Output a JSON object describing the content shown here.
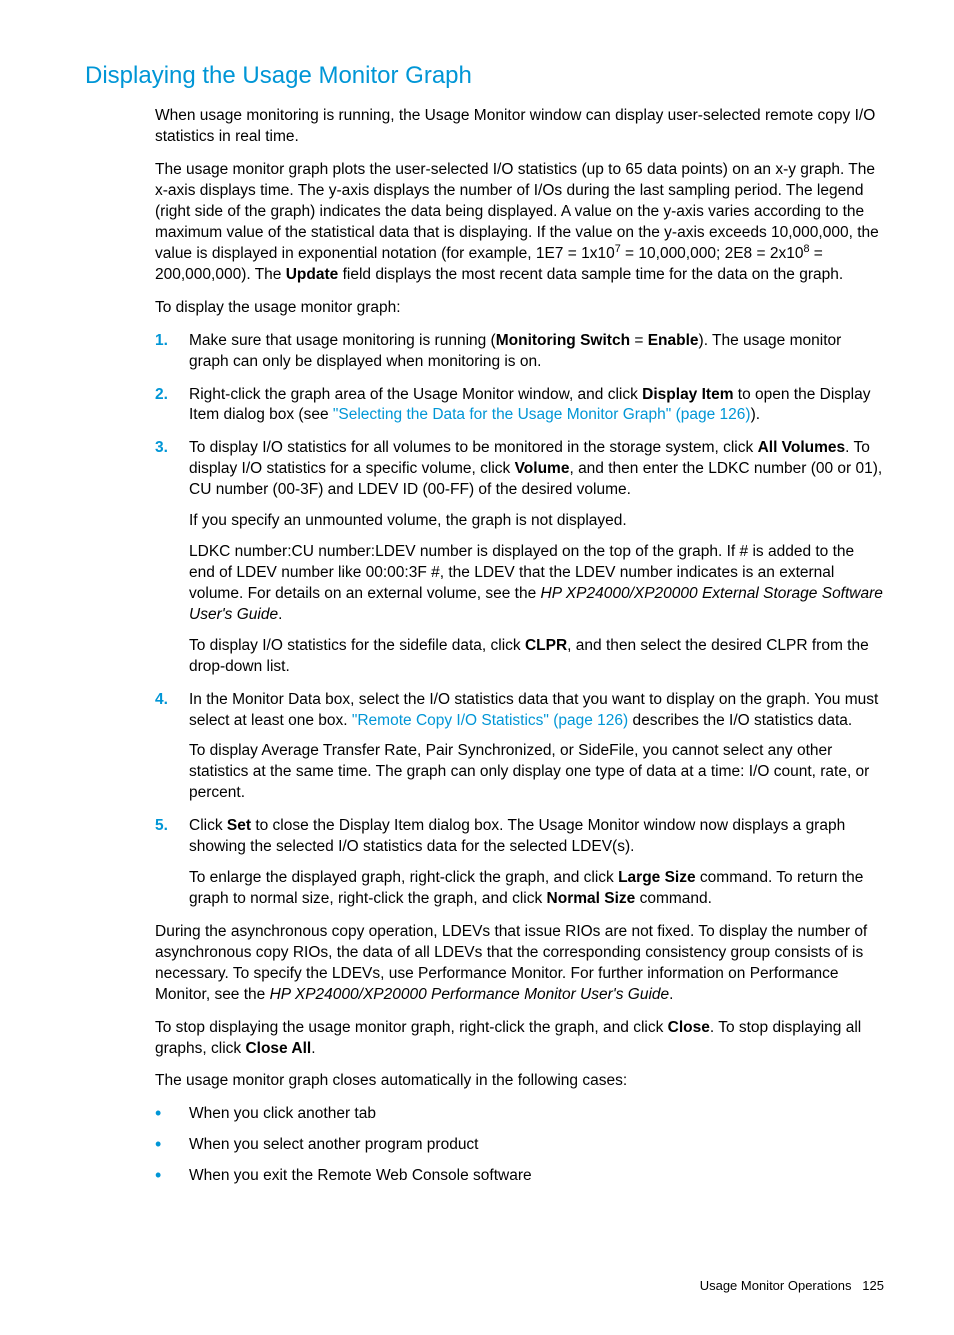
{
  "title": "Displaying the Usage Monitor Graph",
  "intro1": "When usage monitoring is running, the Usage Monitor window can display user-selected remote copy I/O statistics in real time.",
  "intro2_a": "The usage monitor graph plots the user-selected I/O statistics (up to 65 data points) on an x-y graph. The x-axis displays time. The y-axis displays the number of I/Os during the last sampling period. The legend (right side of the graph) indicates the data being displayed. A value on the y-axis varies according to the maximum value of the statistical data that is displaying. If the value on the y-axis exceeds 10,000,000, the value is displayed in exponential notation (for example, 1E7 = 1x10",
  "intro2_seven": "7",
  "intro2_b": " = 10,000,000; 2E8 = 2x10",
  "intro2_eight": "8",
  "intro2_c": " = 200,000,000). The ",
  "intro2_update": "Update",
  "intro2_d": " field displays the most recent data sample time for the data on the graph.",
  "intro3": "To display the usage monitor graph:",
  "steps": [
    {
      "n": "1.",
      "runs": [
        {
          "t": "Make sure that usage monitoring is running ("
        },
        {
          "t": "Monitoring Switch",
          "b": true
        },
        {
          "t": " = "
        },
        {
          "t": "Enable",
          "b": true
        },
        {
          "t": "). The usage monitor graph can only be displayed when monitoring is on."
        }
      ]
    },
    {
      "n": "2.",
      "runs": [
        {
          "t": "Right-click the graph area of the Usage Monitor window, and click "
        },
        {
          "t": "Display Item",
          "b": true
        },
        {
          "t": " to open the Display Item dialog box (see "
        },
        {
          "t": "\"Selecting the Data for the Usage Monitor Graph\" (page 126)",
          "link": true
        },
        {
          "t": ")."
        }
      ]
    },
    {
      "n": "3.",
      "paras": [
        [
          {
            "t": "To display I/O statistics for all volumes to be monitored in the storage system, click "
          },
          {
            "t": "All Volumes",
            "b": true
          },
          {
            "t": ". To display I/O statistics for a specific volume, click "
          },
          {
            "t": "Volume",
            "b": true
          },
          {
            "t": ", and then enter the LDKC number (00 or 01), CU number (00-3F) and LDEV ID (00-FF) of the desired volume."
          }
        ],
        [
          {
            "t": "If you specify an unmounted volume, the graph is not displayed."
          }
        ],
        [
          {
            "t": "LDKC number:CU number:LDEV number is displayed on the top of the graph. If # is added to the end of LDEV number like 00:00:3F #, the LDEV that the LDEV number indicates is an external volume. For details on an external volume, see the "
          },
          {
            "t": "HP XP24000/XP20000 External Storage Software User's Guide",
            "i": true
          },
          {
            "t": "."
          }
        ],
        [
          {
            "t": "To display I/O statistics for the sidefile data, click "
          },
          {
            "t": "CLPR",
            "b": true
          },
          {
            "t": ", and then select the desired CLPR from the drop-down list."
          }
        ]
      ]
    },
    {
      "n": "4.",
      "paras": [
        [
          {
            "t": "In the Monitor Data box, select the I/O statistics data that you want to display on the graph. You must select at least one box. "
          },
          {
            "t": "\"Remote Copy I/O Statistics\" (page 126)",
            "link": true
          },
          {
            "t": " describes the I/O statistics data."
          }
        ],
        [
          {
            "t": "To display Average Transfer Rate, Pair Synchronized, or SideFile, you cannot select any other statistics at the same time. The graph can only display one type of data at a time: I/O count, rate, or percent."
          }
        ]
      ]
    },
    {
      "n": "5.",
      "paras": [
        [
          {
            "t": "Click "
          },
          {
            "t": "Set",
            "b": true
          },
          {
            "t": " to close the Display Item dialog box. The Usage Monitor window now displays a graph showing the selected I/O statistics data for the selected LDEV(s)."
          }
        ],
        [
          {
            "t": "To enlarge the displayed graph, right-click the graph, and click "
          },
          {
            "t": "Large Size",
            "b": true
          },
          {
            "t": " command. To return the graph to normal size, right-click the graph, and click "
          },
          {
            "t": "Normal Size",
            "b": true
          },
          {
            "t": " command."
          }
        ]
      ]
    }
  ],
  "after1": [
    {
      "t": "During the asynchronous copy operation, LDEVs that issue RIOs are not fixed. To display the number of asynchronous copy RIOs, the data of all LDEVs that the corresponding consistency group consists of is necessary. To specify the LDEVs, use Performance Monitor. For further information on Performance Monitor, see the "
    },
    {
      "t": "HP XP24000/XP20000 Performance Monitor User's Guide",
      "i": true
    },
    {
      "t": "."
    }
  ],
  "after2": [
    {
      "t": "To stop displaying the usage monitor graph, right-click the graph, and click "
    },
    {
      "t": "Close",
      "b": true
    },
    {
      "t": ". To stop displaying all graphs, click "
    },
    {
      "t": "Close All",
      "b": true
    },
    {
      "t": "."
    }
  ],
  "after3": "The usage monitor graph closes automatically in the following cases:",
  "bullets": [
    "When you click another tab",
    "When you select another program product",
    "When you exit the Remote Web Console software"
  ],
  "footer_label": "Usage Monitor Operations",
  "footer_page": "125"
}
